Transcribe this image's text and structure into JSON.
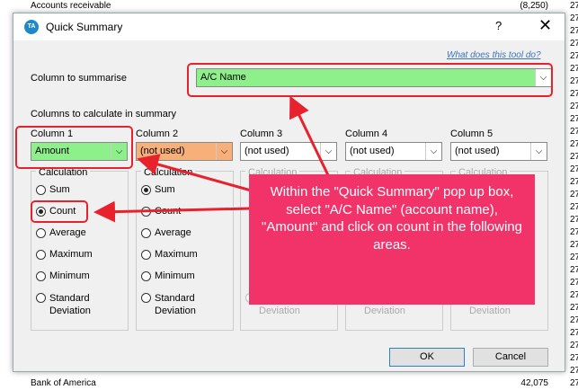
{
  "background": {
    "top_row": {
      "label": "Accounts receivable",
      "amount": "(8,250)",
      "edge": "27"
    },
    "bottom_row": {
      "label": "Bank of America",
      "amount": "42,075",
      "edge": "27"
    },
    "right_edge": [
      "27",
      "27",
      "27",
      "27",
      "27",
      "27",
      "27",
      "27",
      "27",
      "27",
      "27",
      "27",
      "27",
      "27",
      "27",
      "27",
      "27",
      "27",
      "27",
      "27",
      "27",
      "27",
      "27",
      "27",
      "27",
      "27",
      "27",
      "27",
      "27"
    ]
  },
  "dialog": {
    "logo_text": "TA",
    "title": "Quick Summary",
    "help": "?",
    "close": "✕",
    "what_link": "What does this tool do?",
    "summarise_label": "Column to summarise",
    "summarise_value": "A/C Name",
    "calc_label": "Columns to calculate in summary",
    "columns": [
      {
        "title": "Column 1",
        "value": "Amount",
        "color": "#8ef08a",
        "selected": "Count",
        "enabled": true
      },
      {
        "title": "Column 2",
        "value": "(not used)",
        "color": "#f7b07a",
        "selected": "Sum",
        "enabled": true
      },
      {
        "title": "Column 3",
        "value": "(not used)",
        "color": "#ffffff",
        "selected": "",
        "enabled": false
      },
      {
        "title": "Column 4",
        "value": "(not used)",
        "color": "#ffffff",
        "selected": "",
        "enabled": false
      },
      {
        "title": "Column 5",
        "value": "(not used)",
        "color": "#ffffff",
        "selected": "",
        "enabled": false
      }
    ],
    "calculation_title": "Calculation",
    "options": [
      "Sum",
      "Count",
      "Average",
      "Maximum",
      "Minimum"
    ],
    "std_dev": [
      "Standard",
      "Deviation"
    ],
    "ok_label": "OK",
    "cancel_label": "Cancel"
  },
  "colors": {
    "highlight_green": "#8ef08a",
    "annotation_red": "#e8222d",
    "callout_pink": "#f2336a"
  },
  "annotation": {
    "text": "Within the \"Quick Summary\" pop up box, select \"A/C Name\" (account name), \"Amount\" and click on count in the following areas."
  }
}
